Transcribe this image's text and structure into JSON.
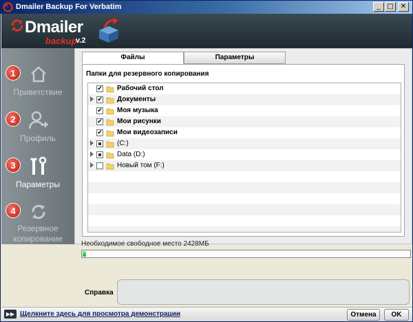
{
  "window": {
    "title": "Dmailer Backup For Verbatim",
    "minimize": "_",
    "maximize": "□",
    "close": "✕"
  },
  "logo": {
    "brand": "Dmailer",
    "sub": "backup",
    "version": "v.2"
  },
  "sidebar": {
    "steps": [
      {
        "number": "1",
        "label": "Приветствие",
        "icon": "home-icon",
        "active": false
      },
      {
        "number": "2",
        "label": "Профиль",
        "icon": "user-add-icon",
        "active": false
      },
      {
        "number": "3",
        "label": "Параметры",
        "icon": "tools-icon",
        "active": true
      },
      {
        "number": "4",
        "label": "Резервное копирование",
        "label_line1": "Резервное",
        "label_line2": "копирование",
        "icon": "sync-icon",
        "active": false
      }
    ]
  },
  "tabs": [
    {
      "label": "Файлы",
      "active": true
    },
    {
      "label": "Параметры",
      "active": false
    }
  ],
  "panel": {
    "title": "Папки для резервного копирования"
  },
  "tree": [
    {
      "label": "Рабочий стол",
      "checked": "checked",
      "expandable": false,
      "bold": true
    },
    {
      "label": "Документы",
      "checked": "checked",
      "expandable": true,
      "bold": true
    },
    {
      "label": "Моя музыка",
      "checked": "checked",
      "expandable": false,
      "bold": true
    },
    {
      "label": "Мои рисунки",
      "checked": "checked",
      "expandable": false,
      "bold": true
    },
    {
      "label": "Мои видеозаписи",
      "checked": "checked",
      "expandable": false,
      "bold": true
    },
    {
      "label": "(C:)",
      "checked": "partial",
      "expandable": true,
      "bold": false
    },
    {
      "label": "Data (D:)",
      "checked": "partial",
      "expandable": true,
      "bold": false
    },
    {
      "label": "Новый том (F:)",
      "checked": "unchecked",
      "expandable": true,
      "bold": false
    }
  ],
  "space": {
    "text": "Необходимое свободное место 2428МБ",
    "progress_fraction": 0.01
  },
  "help": {
    "label": "Справка",
    "content": ""
  },
  "bottom": {
    "demo_icon": "video-icon",
    "demo_link": "Щелкните здесь для просмотра демонстрации",
    "cancel_label": "Отмена",
    "ok_label": "OK"
  },
  "colors": {
    "accent_red": "#E03020",
    "progress_green": "#20B020",
    "header_dark": "#1F2A30"
  }
}
